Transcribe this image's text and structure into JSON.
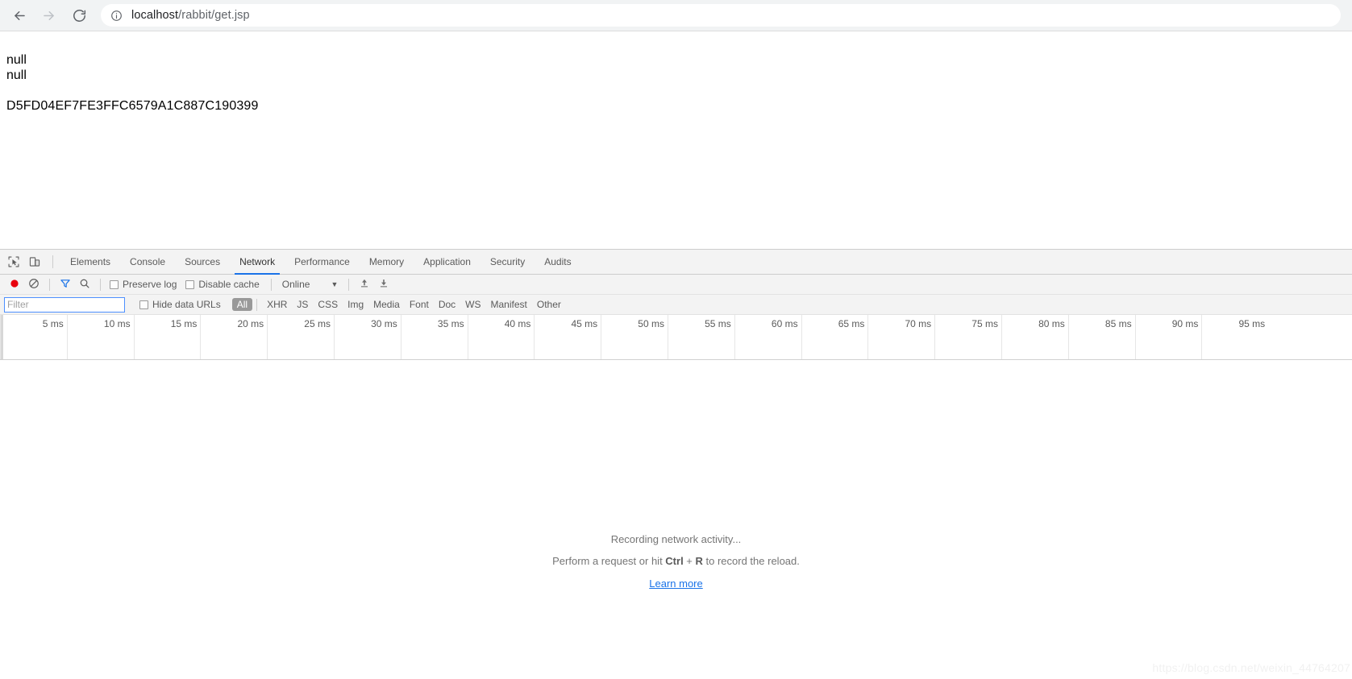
{
  "browser": {
    "back_icon": "arrow-left-icon",
    "forward_icon": "arrow-right-icon",
    "reload_icon": "reload-icon",
    "site_info_icon": "info-circle-icon",
    "url_host": "localhost",
    "url_path": "/rabbit/get.jsp",
    "url_full": "localhost/rabbit/get.jsp"
  },
  "page": {
    "lines": [
      "null",
      "null"
    ],
    "token": "D5FD04EF7FE3FFC6579A1C887C190399"
  },
  "devtools": {
    "inspect_icon": "inspect-element-icon",
    "device_icon": "device-toolbar-icon",
    "tabs": [
      {
        "label": "Elements",
        "selected": false
      },
      {
        "label": "Console",
        "selected": false
      },
      {
        "label": "Sources",
        "selected": false
      },
      {
        "label": "Network",
        "selected": true
      },
      {
        "label": "Performance",
        "selected": false
      },
      {
        "label": "Memory",
        "selected": false
      },
      {
        "label": "Application",
        "selected": false
      },
      {
        "label": "Security",
        "selected": false
      },
      {
        "label": "Audits",
        "selected": false
      }
    ],
    "action_bar": {
      "record_icon": "record-circle-icon",
      "record_color": "#e8000d",
      "clear_icon": "clear-prohibited-icon",
      "filter_icon": "filter-funnel-icon",
      "filter_active_color": "#1a73e8",
      "search_icon": "search-icon",
      "preserve_log_label": "Preserve log",
      "preserve_log_checked": false,
      "disable_cache_label": "Disable cache",
      "disable_cache_checked": false,
      "throttle_value": "Online",
      "throttle_caret_icon": "chevron-down-icon",
      "import_icon": "upload-arrow-icon",
      "export_icon": "download-arrow-icon"
    },
    "filter_bar": {
      "filter_placeholder": "Filter",
      "filter_value": "",
      "hide_data_urls_label": "Hide data URLs",
      "hide_data_urls_checked": false,
      "types": [
        {
          "label": "All",
          "selected": true
        },
        {
          "label": "XHR",
          "selected": false
        },
        {
          "label": "JS",
          "selected": false
        },
        {
          "label": "CSS",
          "selected": false
        },
        {
          "label": "Img",
          "selected": false
        },
        {
          "label": "Media",
          "selected": false
        },
        {
          "label": "Font",
          "selected": false
        },
        {
          "label": "Doc",
          "selected": false
        },
        {
          "label": "WS",
          "selected": false
        },
        {
          "label": "Manifest",
          "selected": false
        },
        {
          "label": "Other",
          "selected": false
        }
      ]
    },
    "timeline": {
      "unit": "ms",
      "ticks": [
        "5 ms",
        "10 ms",
        "15 ms",
        "20 ms",
        "25 ms",
        "30 ms",
        "35 ms",
        "40 ms",
        "45 ms",
        "50 ms",
        "55 ms",
        "60 ms",
        "65 ms",
        "70 ms",
        "75 ms",
        "80 ms",
        "85 ms",
        "90 ms",
        "95 ms"
      ],
      "tick_interval_ms": 5,
      "tick_spacing_px": 82.8
    },
    "empty_state": {
      "title": "Recording network activity...",
      "hint_prefix": "Perform a request or hit ",
      "hint_key1": "Ctrl",
      "hint_plus": " + ",
      "hint_key2": "R",
      "hint_suffix": " to record the reload.",
      "link_label": "Learn more"
    }
  },
  "watermark": "https://blog.csdn.net/weixin_44764207"
}
